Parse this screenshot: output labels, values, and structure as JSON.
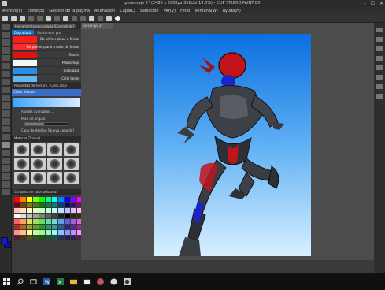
{
  "window": {
    "title": "personaje 2* (2480 x 3508px 350dpi 19.8%) - CLIP STUDIO PAINT EX"
  },
  "menu": [
    "Archivo(F)",
    "Editar(E)",
    "Gestión de la página",
    "Animación",
    "Capa(L)",
    "Selección",
    "Ver(V)",
    "Filtro",
    "Ventana(W)",
    "Ayuda(H)"
  ],
  "subtool_panel": {
    "tab_label": "Herramienta secundaria [Degradado]",
    "selected_group": "Degradado",
    "other_group": "Contornear pro",
    "brushes": [
      {
        "label": "De primer plano a fondo",
        "color": "#ff1a1a"
      },
      {
        "label": "De primer plano a color de fondo",
        "color": "#ff2b2b"
      },
      {
        "label": "Reavs",
        "color": "#e31010"
      },
      {
        "label": "Photoshop",
        "color": "#f5f5f5"
      },
      {
        "label": "Cielo azul",
        "color": "#2a8fe8"
      },
      {
        "label": "Cielo tarde",
        "color": "#5fb9f0"
      }
    ]
  },
  "property_panel": {
    "title": "Propiedad de herram. [Cielo azul]",
    "brush_name": "Cielo diurno",
    "rows": [
      "Ajustes avanzados...",
      "Paso de ángulo",
      "Capa de destino [Nueva capa de]"
    ],
    "angle_value": "45"
  },
  "material_panel": {
    "title": "Material [Trama]"
  },
  "color_set_panel": {
    "title": "Conjunto de color adicional",
    "colors": [
      "#ff0000",
      "#ff8000",
      "#ffff00",
      "#80ff00",
      "#00ff00",
      "#00ff80",
      "#00ffff",
      "#0080ff",
      "#0000ff",
      "#8000ff",
      "#ff00ff",
      "#800000",
      "#804000",
      "#808000",
      "#408000",
      "#008000",
      "#008040",
      "#008080",
      "#004080",
      "#000080",
      "#400080",
      "#800080",
      "#ffc0c0",
      "#ffe0c0",
      "#ffffc0",
      "#e0ffc0",
      "#c0ffc0",
      "#c0ffe0",
      "#c0ffff",
      "#c0e0ff",
      "#c0c0ff",
      "#e0c0ff",
      "#ffc0ff",
      "#ffffff",
      "#e0e0e0",
      "#c0c0c0",
      "#a0a0a0",
      "#808080",
      "#606060",
      "#404040",
      "#202020",
      "#000000",
      "#402000",
      "#204000",
      "#ff6060",
      "#ffa060",
      "#e0e060",
      "#a0e060",
      "#60e060",
      "#60e0a0",
      "#60e0e0",
      "#60a0e0",
      "#6060e0",
      "#a060e0",
      "#e060e0",
      "#c02020",
      "#c06020",
      "#a0a020",
      "#60a020",
      "#20a020",
      "#20a060",
      "#20a0a0",
      "#2060a0",
      "#2020a0",
      "#6020a0",
      "#a020a0",
      "#ff9090",
      "#ffc090",
      "#ffff90",
      "#c0ff90",
      "#90ff90",
      "#90ffc0",
      "#90ffff",
      "#90c0ff",
      "#9090ff",
      "#c090ff",
      "#ff90ff",
      "#502020",
      "#503020",
      "#505020",
      "#305020",
      "#205020",
      "#205030",
      "#205050",
      "#203050",
      "#202050",
      "#302050",
      "#502050"
    ]
  },
  "document": {
    "tab_label": "personaje 2*"
  },
  "colors": {
    "main_color": "#0a1ae0",
    "sub_color": "#0b0bbb",
    "accent": "#1a6fc6"
  },
  "taskbar": {
    "icons": [
      "windows-logo-icon",
      "search-icon",
      "task-view-icon",
      "word-icon",
      "excel-icon",
      "explorer-icon",
      "store-icon",
      "chrome-icon",
      "media-icon",
      "clip-studio-icon"
    ]
  }
}
